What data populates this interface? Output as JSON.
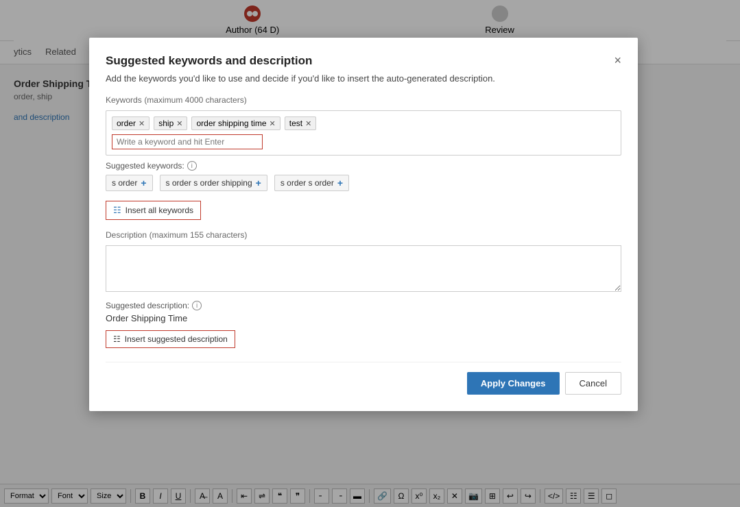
{
  "background": {
    "progress": {
      "step1_label": "Author (64 D)",
      "step2_label": "Review"
    },
    "tabs": [
      "ytics",
      "Related"
    ],
    "content": {
      "title": "Order Shipping Time",
      "subtitle": "order, ship"
    },
    "link_text": "and description"
  },
  "modal": {
    "title": "Suggested keywords and description",
    "subtitle": "Add the keywords you'd like to use and decide if you'd like to insert the auto-generated description.",
    "close_label": "×",
    "keywords": {
      "label": "Keywords",
      "label_note": "(maximum 4000 characters)",
      "tags": [
        {
          "text": "order"
        },
        {
          "text": "ship"
        },
        {
          "text": "order shipping time"
        },
        {
          "text": "test"
        }
      ],
      "input_placeholder": "Write a keyword and hit Enter"
    },
    "suggested_keywords": {
      "label": "Suggested keywords:",
      "items": [
        {
          "text": "s order"
        },
        {
          "text": "s order s order shipping"
        },
        {
          "text": "s order s order"
        }
      ]
    },
    "insert_all_btn": "Insert all keywords",
    "description": {
      "label": "Description",
      "label_note": "(maximum 155 characters)",
      "placeholder": ""
    },
    "suggested_description": {
      "label": "Suggested description:",
      "text": "Order Shipping Time"
    },
    "insert_desc_btn": "Insert suggested description",
    "footer": {
      "apply_label": "Apply Changes",
      "cancel_label": "Cancel"
    }
  },
  "toolbar": {
    "format_label": "Format",
    "font_label": "Font",
    "size_label": "Size",
    "bold": "B",
    "italic": "I",
    "underline": "U"
  }
}
